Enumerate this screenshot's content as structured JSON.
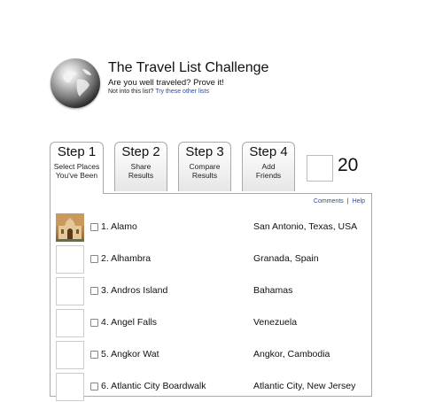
{
  "header": {
    "title": "The Travel List Challenge",
    "subtitle": "Are you well traveled? Prove it!",
    "note_prefix": "Not into this list?",
    "note_link": "Try these other lists"
  },
  "tabs": [
    {
      "label": "Step 1",
      "sub1": "Select Places",
      "sub2": "You've Been",
      "active": true
    },
    {
      "label": "Step 2",
      "sub1": "Share",
      "sub2": "Results",
      "active": false
    },
    {
      "label": "Step 3",
      "sub1": "Compare",
      "sub2": "Results",
      "active": false
    },
    {
      "label": "Step 4",
      "sub1": "Add",
      "sub2": "Friends",
      "active": false
    }
  ],
  "counter": {
    "value": "20"
  },
  "panel_links": {
    "comments": "Comments",
    "separator": "|",
    "help": "Help"
  },
  "places": [
    {
      "name": "1. Alamo",
      "location": "San Antonio, Texas, USA",
      "has_photo": true,
      "icon": "alamo-photo"
    },
    {
      "name": "2. Alhambra",
      "location": "Granada, Spain",
      "has_photo": false
    },
    {
      "name": "3. Andros Island",
      "location": "Bahamas",
      "has_photo": false
    },
    {
      "name": "4. Angel Falls",
      "location": "Venezuela",
      "has_photo": false
    },
    {
      "name": "5. Angkor Wat",
      "location": "Angkor, Cambodia",
      "has_photo": false
    },
    {
      "name": "6. Atlantic City Boardwalk",
      "location": "Atlantic City, New Jersey",
      "has_photo": false
    }
  ],
  "colors": {
    "link": "#2a4b9c",
    "tab_border": "#aaaaaa"
  }
}
